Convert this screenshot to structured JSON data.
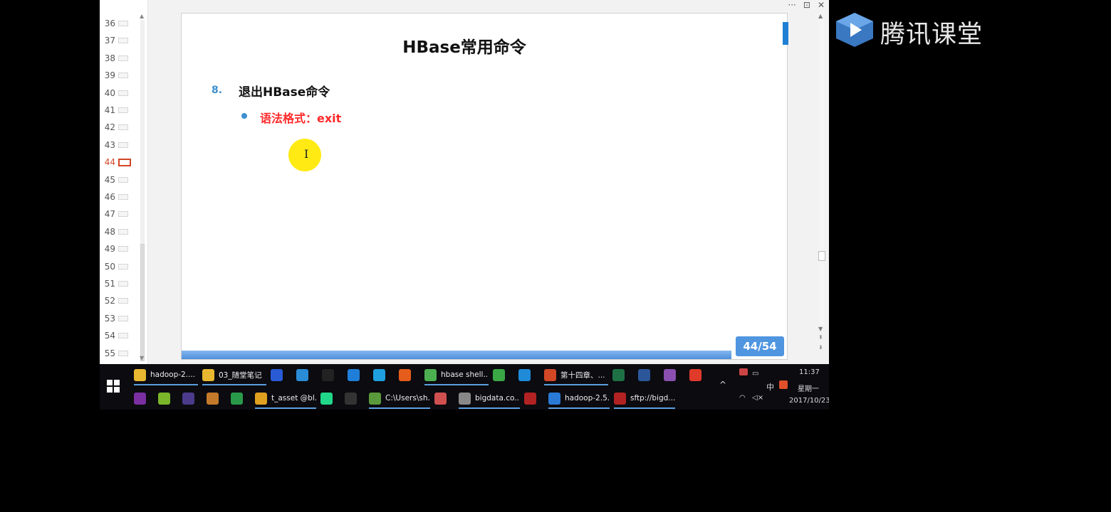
{
  "rail": {
    "slides": [
      "36",
      "37",
      "38",
      "39",
      "40",
      "41",
      "42",
      "43",
      "44",
      "45",
      "46",
      "47",
      "48",
      "49",
      "50",
      "51",
      "52",
      "53",
      "54",
      "55"
    ],
    "active": "44"
  },
  "slide": {
    "title": "HBase常用命令",
    "item_number": "8.",
    "item_text": "退出HBase命令",
    "syntax": "语法格式：exit",
    "page": "44/54"
  },
  "window_controls": [
    "···",
    "⊡",
    "✕"
  ],
  "taskbar": {
    "row1": [
      {
        "label": "hadoop-2....",
        "icon": "folder-icon",
        "color": "#e8b830"
      },
      {
        "label": "03_随堂笔记",
        "icon": "folder-icon",
        "color": "#e8b830"
      },
      {
        "label": "",
        "icon": "g-app-icon",
        "color": "#2a5bd7"
      },
      {
        "label": "",
        "icon": "cloud-icon",
        "color": "#2a8bd7"
      },
      {
        "label": "",
        "icon": "qq-icon",
        "color": "#222"
      },
      {
        "label": "",
        "icon": "kuwo-icon",
        "color": "#1f7fd8"
      },
      {
        "label": "",
        "icon": "ie-icon",
        "color": "#1fa0e0"
      },
      {
        "label": "",
        "icon": "firefox-icon",
        "color": "#e65c1a"
      },
      {
        "label": "hbase shell...",
        "icon": "chrome-icon",
        "color": "#4caf50"
      },
      {
        "label": "",
        "icon": "sync-icon",
        "color": "#3aa845"
      },
      {
        "label": "",
        "icon": "bird-icon",
        "color": "#1f8ad8"
      },
      {
        "label": "第十四章、...",
        "icon": "powerpoint-icon",
        "color": "#d24726"
      },
      {
        "label": "",
        "icon": "excel-icon",
        "color": "#1e7145"
      },
      {
        "label": "",
        "icon": "word-icon",
        "color": "#2b579a"
      },
      {
        "label": "",
        "icon": "winrar-icon",
        "color": "#8a4fb0"
      },
      {
        "label": "",
        "icon": "xmind-icon",
        "color": "#e03a2a"
      }
    ],
    "row2": [
      {
        "label": "",
        "icon": "axure-icon",
        "color": "#7b2fa0"
      },
      {
        "label": "",
        "icon": "green-app-icon",
        "color": "#7ab52a"
      },
      {
        "label": "",
        "icon": "eclipse-icon",
        "color": "#4b3b8a"
      },
      {
        "label": "",
        "icon": "coffee-icon",
        "color": "#c47a2a"
      },
      {
        "label": "",
        "icon": "diagram-icon",
        "color": "#2a9a4a"
      },
      {
        "label": "t_asset @bl...",
        "icon": "navicat-icon",
        "color": "#e0a020"
      },
      {
        "label": "",
        "icon": "pycharm-icon",
        "color": "#21d789"
      },
      {
        "label": "",
        "icon": "intellij-icon",
        "color": "#333"
      },
      {
        "label": "C:\\Users\\sh...",
        "icon": "notepad-icon",
        "color": "#5a9a3a"
      },
      {
        "label": "",
        "icon": "eraser-icon",
        "color": "#d05050"
      },
      {
        "label": "bigdata.co...",
        "icon": "image-viewer-icon",
        "color": "#888"
      },
      {
        "label": "",
        "icon": "filezilla-icon",
        "color": "#b22222"
      },
      {
        "label": "hadoop-2.5...",
        "icon": "vm-icon",
        "color": "#2a7ad7"
      },
      {
        "label": "sftp://bigd...",
        "icon": "filezilla-icon",
        "color": "#b22222"
      }
    ],
    "tray": {
      "ime": "中",
      "time": "11:37",
      "weekday": "星期一",
      "date": "2017/10/23"
    }
  },
  "brand": {
    "name": "腾讯课堂"
  }
}
